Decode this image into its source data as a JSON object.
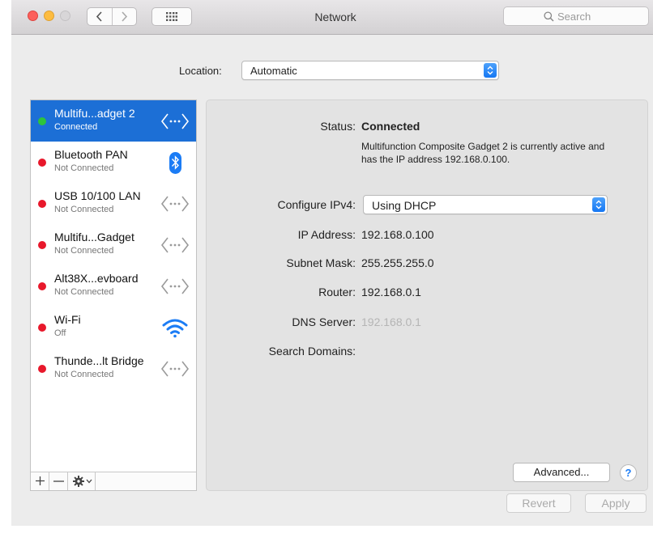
{
  "window": {
    "title": "Network"
  },
  "search": {
    "placeholder": "Search"
  },
  "location": {
    "label": "Location:",
    "value": "Automatic"
  },
  "services": [
    {
      "name": "Multifu...adget 2",
      "status": "Connected",
      "state": "green",
      "icon": "ethernet-arrows-icon",
      "selected": true
    },
    {
      "name": "Bluetooth PAN",
      "status": "Not Connected",
      "state": "red",
      "icon": "bluetooth-icon",
      "selected": false
    },
    {
      "name": "USB 10/100 LAN",
      "status": "Not Connected",
      "state": "red",
      "icon": "ethernet-arrows-icon",
      "selected": false
    },
    {
      "name": "Multifu...Gadget",
      "status": "Not Connected",
      "state": "red",
      "icon": "ethernet-arrows-icon",
      "selected": false
    },
    {
      "name": "Alt38X...evboard",
      "status": "Not Connected",
      "state": "red",
      "icon": "ethernet-arrows-icon",
      "selected": false
    },
    {
      "name": "Wi-Fi",
      "status": "Off",
      "state": "red",
      "icon": "wifi-icon",
      "selected": false
    },
    {
      "name": "Thunde...lt Bridge",
      "status": "Not Connected",
      "state": "red",
      "icon": "ethernet-arrows-icon",
      "selected": false
    }
  ],
  "sidebar_footer": {
    "add": "+",
    "remove": "—"
  },
  "detail": {
    "status_label": "Status:",
    "status_value": "Connected",
    "status_desc": "Multifunction Composite Gadget 2 is currently active and has the IP address 192.168.0.100.",
    "configure_label": "Configure IPv4:",
    "configure_value": "Using DHCP",
    "ip_label": "IP Address:",
    "ip_value": "192.168.0.100",
    "subnet_label": "Subnet Mask:",
    "subnet_value": "255.255.255.0",
    "router_label": "Router:",
    "router_value": "192.168.0.1",
    "dns_label": "DNS Server:",
    "dns_value": "192.168.0.1",
    "search_domains_label": "Search Domains:",
    "advanced_label": "Advanced...",
    "help_label": "?"
  },
  "buttons": {
    "revert": "Revert",
    "apply": "Apply"
  },
  "colors": {
    "selection": "#1c6fd6",
    "status_green": "#2dc43b",
    "status_red": "#e8182b",
    "accent_blue": "#1b7cf5"
  }
}
